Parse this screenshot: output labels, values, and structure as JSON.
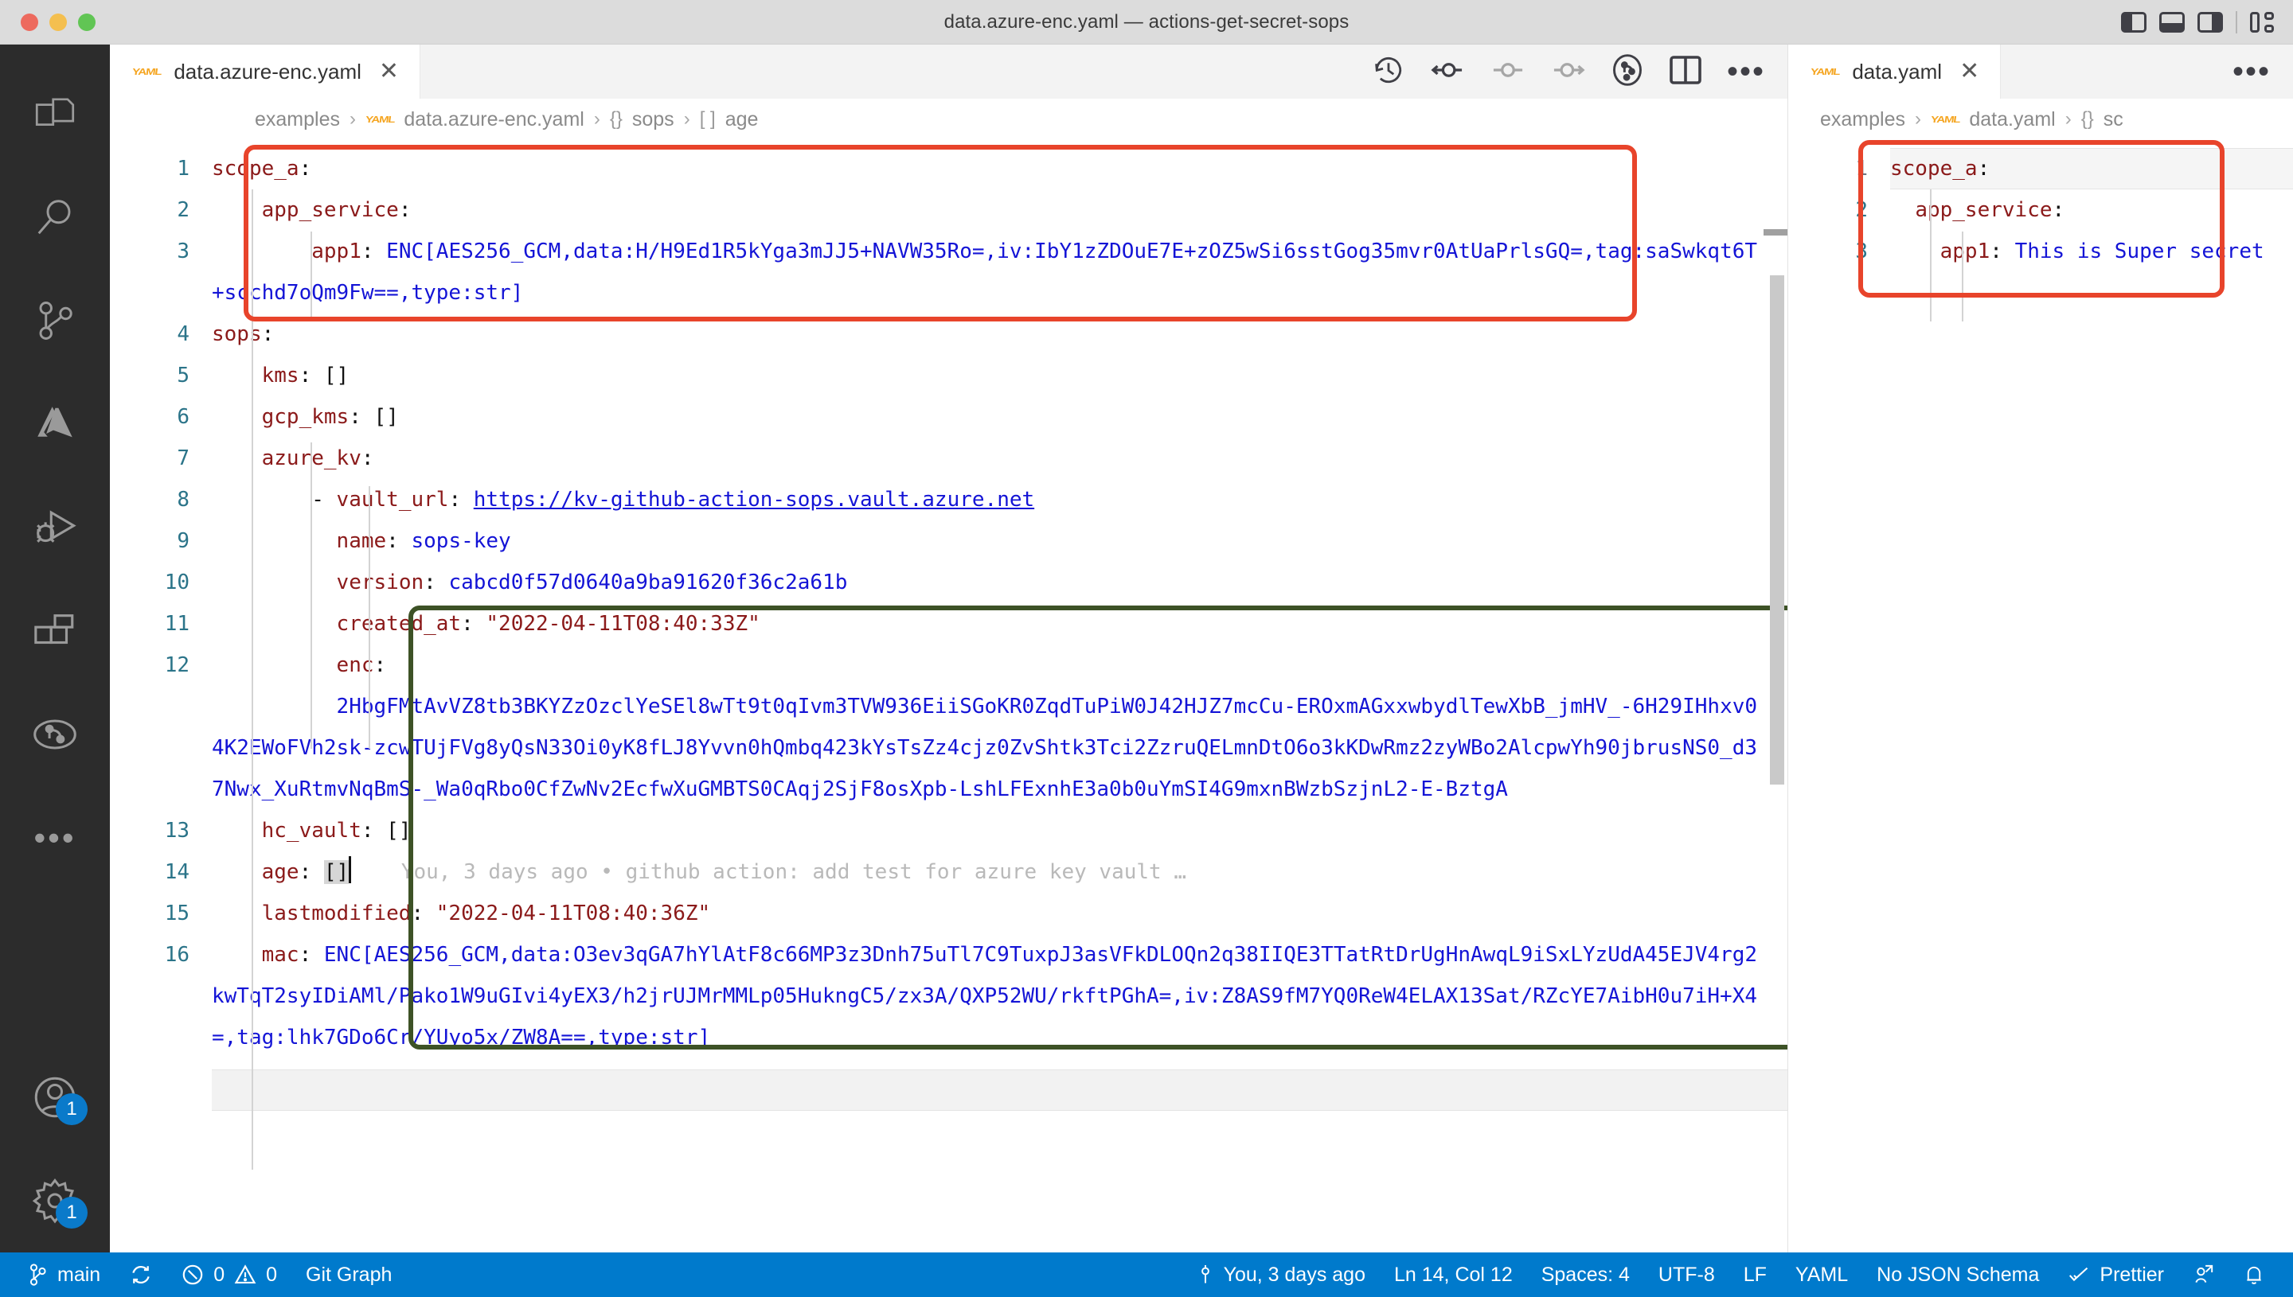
{
  "window": {
    "title": "data.azure-enc.yaml — actions-get-secret-sops",
    "traffic_lights": [
      "close",
      "minimize",
      "zoom"
    ],
    "layout_controls": [
      "toggle-primary-sidebar",
      "toggle-panel",
      "toggle-secondary-sidebar",
      "customize-layout"
    ]
  },
  "activitybar": {
    "items": [
      {
        "name": "explorer",
        "icon": "files-icon"
      },
      {
        "name": "search",
        "icon": "search-icon"
      },
      {
        "name": "source-control",
        "icon": "source-control-icon"
      },
      {
        "name": "azure",
        "icon": "azure-icon"
      },
      {
        "name": "run-and-debug",
        "icon": "run-debug-icon"
      },
      {
        "name": "extensions",
        "icon": "extensions-icon"
      },
      {
        "name": "git-graph",
        "icon": "git-graph-icon"
      },
      {
        "name": "more",
        "icon": "ellipsis-icon"
      }
    ],
    "bottom": [
      {
        "name": "accounts",
        "icon": "account-icon",
        "badge": "1"
      },
      {
        "name": "manage",
        "icon": "gear-icon",
        "badge": "1"
      }
    ]
  },
  "editors": {
    "left": {
      "tab": {
        "label": "data.azure-enc.yaml",
        "icon": "yaml-icon",
        "close": "✕",
        "active": true
      },
      "breadcrumb": [
        {
          "text": "examples",
          "symbol": ""
        },
        {
          "text": "data.azure-enc.yaml",
          "symbol": "yaml-icon"
        },
        {
          "text": "sops",
          "symbol": "{}"
        },
        {
          "text": "age",
          "symbol": "[ ]"
        }
      ],
      "toolbar": [
        {
          "name": "timeline-history",
          "icon": "history-icon"
        },
        {
          "name": "previous-change",
          "icon": "arrow-circle-left-icon"
        },
        {
          "name": "compare-change",
          "icon": "circle-dash-icon"
        },
        {
          "name": "next-change",
          "icon": "arrow-circle-right-icon"
        },
        {
          "name": "git-lens-blame",
          "icon": "git-commit-circle-icon"
        },
        {
          "name": "split-editor",
          "icon": "split-editor-icon"
        },
        {
          "name": "more-actions",
          "icon": "ellipsis-icon"
        }
      ],
      "lines": [
        {
          "num": "1",
          "segments": [
            {
              "c": "k",
              "t": "scope_a"
            },
            {
              "c": "p",
              "t": ":"
            }
          ]
        },
        {
          "num": "2",
          "indent": 1,
          "segments": [
            {
              "c": "k",
              "t": "app_service"
            },
            {
              "c": "p",
              "t": ":"
            }
          ]
        },
        {
          "num": "3",
          "indent": 2,
          "segments": [
            {
              "c": "k",
              "t": "app1"
            },
            {
              "c": "p",
              "t": ": "
            },
            {
              "c": "v",
              "t": "ENC[AES256_GCM,data:H/H9Ed1R5kYga3mJJ5+NAVW35Ro=,iv:IbY1zZDOuE7E+zOZ5wSi6sstGog35mvr0AtUaPrlsGQ=,tag:saSwkqt6T+scchd7oQm9Fw==,type:str]"
            }
          ]
        },
        {
          "num": "4",
          "segments": [
            {
              "c": "k",
              "t": "sops"
            },
            {
              "c": "p",
              "t": ":"
            }
          ]
        },
        {
          "num": "5",
          "indent": 1,
          "segments": [
            {
              "c": "k",
              "t": "kms"
            },
            {
              "c": "p",
              "t": ": []"
            }
          ]
        },
        {
          "num": "6",
          "indent": 1,
          "segments": [
            {
              "c": "k",
              "t": "gcp_kms"
            },
            {
              "c": "p",
              "t": ": []"
            }
          ]
        },
        {
          "num": "7",
          "indent": 1,
          "segments": [
            {
              "c": "k",
              "t": "azure_kv"
            },
            {
              "c": "p",
              "t": ":"
            }
          ]
        },
        {
          "num": "8",
          "indent": 2,
          "segments": [
            {
              "c": "p",
              "t": "- "
            },
            {
              "c": "k",
              "t": "vault_url"
            },
            {
              "c": "p",
              "t": ": "
            },
            {
              "c": "lnk",
              "t": "https://kv-github-action-sops.vault.azure.net"
            }
          ]
        },
        {
          "num": "9",
          "indent": 3,
          "segments": [
            {
              "c": "k",
              "t": "name"
            },
            {
              "c": "p",
              "t": ": "
            },
            {
              "c": "v",
              "t": "sops-key"
            }
          ]
        },
        {
          "num": "10",
          "indent": 3,
          "segments": [
            {
              "c": "k",
              "t": "version"
            },
            {
              "c": "p",
              "t": ": "
            },
            {
              "c": "v",
              "t": "cabcd0f57d0640a9ba91620f36c2a61b"
            }
          ]
        },
        {
          "num": "11",
          "indent": 3,
          "segments": [
            {
              "c": "k",
              "t": "created_at"
            },
            {
              "c": "p",
              "t": ": "
            },
            {
              "c": "s",
              "t": "\"2022-04-11T08:40:33Z\""
            }
          ]
        },
        {
          "num": "12",
          "indent": 3,
          "segments": [
            {
              "c": "k",
              "t": "enc"
            },
            {
              "c": "p",
              "t": ":"
            }
          ]
        },
        {
          "num": "",
          "indent": 3,
          "wrapped": true,
          "segments": [
            {
              "c": "v",
              "t": "2HbgFMtAvVZ8tb3BKYZzOzclYeSEl8wTt9t0qIvm3TVW936EiiSGoKR0ZqdTuPiW0J42HJZ7mcCu-EROxmAGxxwbydlTewXbB_jmHV_-6H29IHhxv04K2EWoFVh2sk-zcwTUjFVg8yQsN33Oi0yK8fLJ8Yvvn0hQmbq423kYsTsZz4cjz0ZvShtk3Tci2ZzruQELmnDtO6o3kKDwRmz2zyWBo2AlcpwYh90jbrusNS0_d37Nwx_XuRtmvNqBmS-_Wa0qRbo0CfZwNv2EcfwXuGMBTS0CAqj2SjF8osXpb-LshLFExnhE3a0b0uYmSI4G9mxnBWzbSzjnL2-E-BztgA"
            }
          ]
        },
        {
          "num": "13",
          "indent": 1,
          "segments": [
            {
              "c": "k",
              "t": "hc_vault"
            },
            {
              "c": "p",
              "t": ": []"
            }
          ]
        },
        {
          "num": "14",
          "indent": 1,
          "active": true,
          "segments": [
            {
              "c": "k",
              "t": "age"
            },
            {
              "c": "p",
              "t": ": "
            },
            {
              "c": "sel",
              "t": "[]"
            }
          ],
          "blame": "You, 3 days ago • github action: add test for azure key vault …"
        },
        {
          "num": "15",
          "indent": 1,
          "segments": [
            {
              "c": "k",
              "t": "lastmodified"
            },
            {
              "c": "p",
              "t": ": "
            },
            {
              "c": "s",
              "t": "\"2022-04-11T08:40:36Z\""
            }
          ]
        },
        {
          "num": "16",
          "indent": 1,
          "segments": [
            {
              "c": "k",
              "t": "mac"
            },
            {
              "c": "p",
              "t": ": "
            },
            {
              "c": "v",
              "t": "ENC[AES256_GCM,data:O3ev3qGA7hYlAtF8c66MP3z3Dnh75uTl7C9TuxpJ3asVFkDLOQn2q38IIQE3TTatRtDrUgHnAwqL9iSxLYzUdA45EJV4rg2kwTqT2syIDiAMl/Pako1W9uGIvi4yEX3/h2jrUJMrMMLp05HukngC5/zx3A/QXP52WU/rkftPGhA=,iv:Z8AS9fM7YQ0ReW4ELAX13Sat/RZcYE7AibH0u7iH+X4=,tag:lhk7GDo6Cr/YUyo5x/ZW8A==,type:str]"
            }
          ]
        }
      ]
    },
    "right": {
      "tab": {
        "label": "data.yaml",
        "icon": "yaml-icon",
        "close": "✕",
        "active": true
      },
      "breadcrumb": [
        {
          "text": "examples",
          "symbol": ""
        },
        {
          "text": "data.yaml",
          "symbol": "yaml-icon"
        },
        {
          "text": "sc",
          "symbol": "{}"
        }
      ],
      "toolbar": [
        {
          "name": "more-actions",
          "icon": "ellipsis-icon"
        }
      ],
      "lines": [
        {
          "num": "1",
          "segments": [
            {
              "c": "k",
              "t": "scope_a"
            },
            {
              "c": "p",
              "t": ":"
            }
          ]
        },
        {
          "num": "2",
          "indent": 1,
          "segments": [
            {
              "c": "k",
              "t": "app_service"
            },
            {
              "c": "p",
              "t": ":"
            }
          ]
        },
        {
          "num": "3",
          "indent": 2,
          "segments": [
            {
              "c": "k",
              "t": "app1"
            },
            {
              "c": "p",
              "t": ": "
            },
            {
              "c": "v",
              "t": "This is Super secret"
            }
          ]
        }
      ]
    }
  },
  "annotations": [
    {
      "name": "highlight-encrypted-value",
      "color": "#e8442b",
      "shape": "rounded-rect"
    },
    {
      "name": "highlight-azure-kv-block",
      "color": "#3d5226",
      "shape": "rounded-rect"
    },
    {
      "name": "highlight-decrypted-value",
      "color": "#e8442b",
      "shape": "rounded-rect"
    }
  ],
  "statusbar": {
    "left": [
      {
        "name": "branch",
        "icon": "source-control-icon",
        "label": "main"
      },
      {
        "name": "sync",
        "icon": "sync-icon",
        "label": ""
      },
      {
        "name": "problems",
        "icon": "error-warning-icon",
        "label": "0 ⚠ 0",
        "errors": "0",
        "warnings": "0"
      },
      {
        "name": "git-graph",
        "icon": "",
        "label": "Git Graph"
      }
    ],
    "right": [
      {
        "name": "blame",
        "icon": "git-commit-icon",
        "label": "You, 3 days ago"
      },
      {
        "name": "cursor-position",
        "icon": "",
        "label": "Ln 14, Col 12"
      },
      {
        "name": "indentation",
        "icon": "",
        "label": "Spaces: 4"
      },
      {
        "name": "encoding",
        "icon": "",
        "label": "UTF-8"
      },
      {
        "name": "eol",
        "icon": "",
        "label": "LF"
      },
      {
        "name": "language-mode",
        "icon": "",
        "label": "YAML"
      },
      {
        "name": "json-schema",
        "icon": "",
        "label": "No JSON Schema"
      },
      {
        "name": "prettier",
        "icon": "check-icon",
        "label": "Prettier"
      },
      {
        "name": "remote-share",
        "icon": "live-share-icon",
        "label": ""
      },
      {
        "name": "notifications",
        "icon": "bell-icon",
        "label": ""
      }
    ]
  },
  "colors": {
    "accent": "#007acc",
    "key": "#8b1a1a",
    "value": "#1414d6",
    "annotation_red": "#e8442b",
    "annotation_green": "#3d5226",
    "activitybar_bg": "#2c2c2c",
    "titlebar_bg": "#dcdcdc"
  }
}
